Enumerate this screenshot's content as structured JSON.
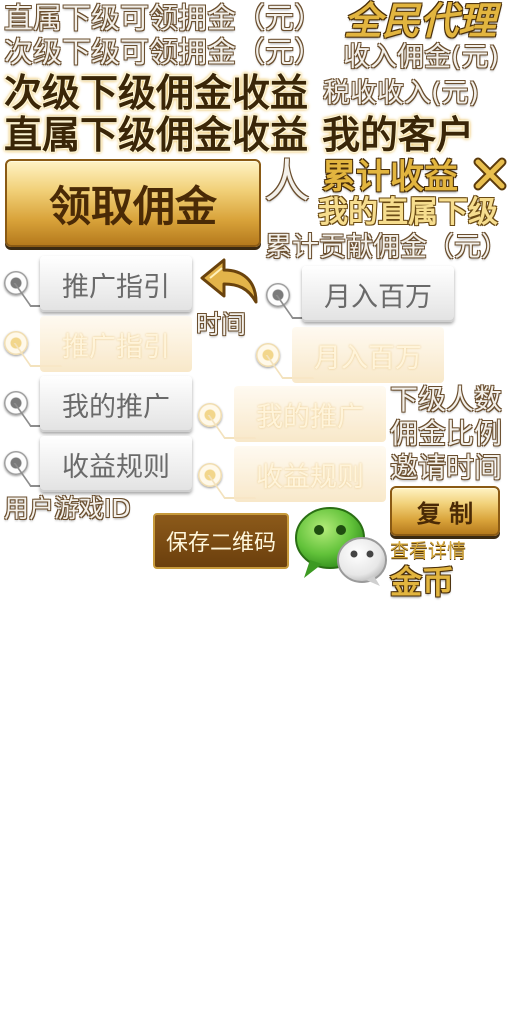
{
  "labels": {
    "direct_claimable": "直属下级可领拥金（元）",
    "secondary_claimable": "次级下级可领拥金（元）",
    "all_agent": "全民代理",
    "income_commission": "收入佣金(元)",
    "secondary_commission_income": "次级下级佣金收益",
    "tax_income": "税收收入(元)",
    "direct_commission_income": "直属下级佣金收益",
    "my_customers": "我的客户",
    "person_unit": "人",
    "cumulative_income": "累计收益",
    "my_direct": "我的直属下级",
    "cumulative_contribution": "累计贡献佣金（元）",
    "time": "时间",
    "subordinate_count": "下级人数",
    "commission_ratio": "佣金比例",
    "invite_time": "邀请时间",
    "user_game_id": "用户游戏ID",
    "view_details": "查看详情",
    "gold_coin": "金币"
  },
  "buttons": {
    "claim_commission": "领取佣金",
    "copy": "复 制",
    "save_qr": "保存二维码"
  },
  "tabs_left": [
    {
      "label": "推广指引",
      "state": "normal"
    },
    {
      "label": "推广指引",
      "state": "active"
    },
    {
      "label": "我的推广",
      "state": "normal"
    },
    {
      "label": "收益规则",
      "state": "normal"
    }
  ],
  "tabs_right": [
    {
      "label": "月入百万",
      "state": "normal"
    },
    {
      "label": "月入百万",
      "state": "active"
    },
    {
      "label": "我的推广",
      "state": "active"
    },
    {
      "label": "收益规则",
      "state": "active"
    }
  ],
  "colors": {
    "gold": "#e2b53f",
    "dark_brown": "#3a2608",
    "button_gold": "#d9a33a",
    "wechat_green": "#62c23a"
  },
  "icons": [
    "close-icon",
    "back-arrow-icon",
    "wechat-icon",
    "radio-icon"
  ]
}
